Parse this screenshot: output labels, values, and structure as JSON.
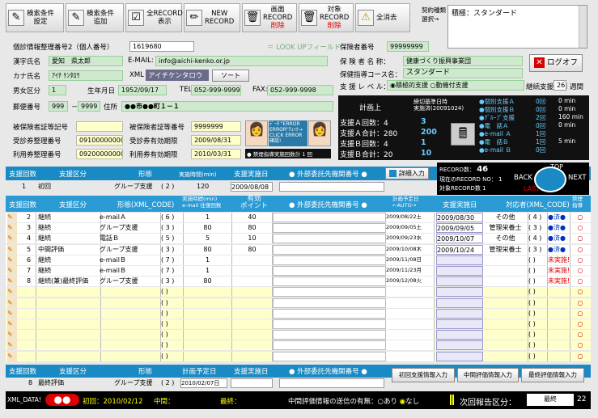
{
  "toolbar": {
    "search_settings": "検索条件\n設定",
    "search_add": "検索条件\n追加",
    "all_display": "全RECORD\n表示",
    "new_record": "NEW\nRECORD",
    "screen_record": "画面\nRECORD",
    "screen_record_sub": "削除",
    "target_record": "対象\nRECORD",
    "target_record_sub": "削除",
    "all_clear": "全消去",
    "contract_label": "契約種類\n選択→",
    "contract_value": "積極：スタンダード"
  },
  "person": {
    "card_no_label": "個診情報整理番号2（個人番号）",
    "card_no": "1619680",
    "lookup": "＝ LOOK UPフィールド",
    "kanji_label": "漢字氏名",
    "kanji": "愛知　県太郎",
    "email_label": "E-MAIL:",
    "email": "info@aichi-kenko.or.jp",
    "kana_label": "カナ氏名",
    "kana": "ｱｲﾁ ｹﾝﾀﾛｳ",
    "xml_label": "XML",
    "xml_kana": "アイチケンタロウ",
    "sort": "ソート",
    "gender_label": "男女区分",
    "gender": "1",
    "birth_label": "生年月日",
    "birth": "1952/09/17",
    "tel_label": "TEL:",
    "tel": "052-999-9999",
    "fax_label": "FAX:",
    "fax": "052-999-9998",
    "post_label": "郵便番号",
    "post1": "999",
    "post2": "9999",
    "addr_label": "住所",
    "addr": "●●市●●町１－１"
  },
  "insurer": {
    "no_label": "保険者番号",
    "no": "99999999",
    "name_label": "保 険 者 名 称：",
    "name": "健康づくり振興事業団",
    "course_label": "保健指導コース名：",
    "course": "スタンダード",
    "level_label": "支 援 レ ベ ル：",
    "level_opt1": "積極的支援",
    "level_opt2": "動機付支援",
    "period_label": "継続支援期間",
    "period": "26",
    "weeks": "週間",
    "logoff": "ログオフ"
  },
  "ins_cards": {
    "r1_label": "被保険者証等記号",
    "r1_label2": "被保険者証等番号",
    "r1_val2": "9999999",
    "r2_label": "受診券整理番号",
    "r2_val": "09100000000",
    "r2_label2": "受診券有効期限",
    "r2_val2": "2009/08/31",
    "r3_label": "利用券整理番号",
    "r3_val": "09200000000",
    "r3_label2": "利用券有効期限",
    "r3_val2": "2010/03/31",
    "err_text": "ﾃﾞｰﾀ \"ERROR ERROR\"ﾁｪｯｸ→ CLICK ERROR確認!",
    "check_label": "● 禁煙指導実施回数計 1 回"
  },
  "plan": {
    "title": "計画上",
    "actual_label": "実施済(",
    "cut_label": "締切基準日時",
    "cut_date": "20091024",
    "rows": [
      {
        "label": "支援Ａ回数：4",
        "v": "3"
      },
      {
        "label": "支援Ａ合計：280",
        "v": "200"
      },
      {
        "label": "支援Ｂ回数：4",
        "v": "1"
      },
      {
        "label": "支援Ｂ合計：20",
        "v": "10"
      }
    ],
    "right": [
      {
        "l": "●個別支援Ａ",
        "n": "0回",
        "m": "0 min"
      },
      {
        "l": "●個別支援Ｂ",
        "n": "0回",
        "m": "0 min"
      },
      {
        "l": "●ｸﾞﾙｰﾌﾟ支援",
        "n": "2回",
        "m": "160 min"
      },
      {
        "l": "●電　話Ａ",
        "n": "0回",
        "m": "0 min"
      },
      {
        "l": "●e-mail Ａ",
        "n": "1回",
        "m": ""
      },
      {
        "l": "●電　話Ｂ",
        "n": "1回",
        "m": "5 min"
      },
      {
        "l": "●e-mail Ｂ",
        "n": "0回",
        "m": ""
      }
    ]
  },
  "nav": {
    "rec_label": "RECORD数：",
    "rec": "46",
    "cur_label": "現在のRECORD NO：",
    "cur": "1",
    "tgt_label": "対象RECORD数",
    "tgt": "1",
    "top": "TOP",
    "back": "BACK",
    "next": "NEXT",
    "last": "LAST"
  },
  "first_section": {
    "headers": [
      "支援回数",
      "支援区分",
      "形態",
      "実施時間(min)",
      "支援実施日",
      "● 外部委託先機関番号 ●"
    ],
    "detail_btn": "詳細入力",
    "row": {
      "no": "1",
      "kubun": "初回",
      "keitai": "グループ支援",
      "code": "( 2 )",
      "time": "120",
      "date": "2009/08/08"
    }
  },
  "cont_section": {
    "headers": [
      "支援回数",
      "支援区分",
      "形態(XML_CODE)",
      "実施時間(min)\ne-mail 往復回数",
      "有効\nポイント",
      "● 外部委託先機関番号 ●",
      "計画予定日\n←AUTO→",
      "支援実施日",
      "対応者(XML_CODE)",
      "禁煙\n指導"
    ],
    "rows": [
      {
        "no": "2",
        "kubun": "継続",
        "keitai": "e-mailＡ",
        "code": "( 6 )",
        "time": "1",
        "pt": "40",
        "plan": "2009/08/22土",
        "date": "2009/08/30",
        "who": "その他",
        "wcode": "( 4 )",
        "st": "●済●"
      },
      {
        "no": "3",
        "kubun": "継続",
        "keitai": "グループ支援",
        "code": "( 3 )",
        "time": "80",
        "pt": "80",
        "plan": "2009/09/05土",
        "date": "2009/09/05",
        "who": "管理栄養士",
        "wcode": "( 3 )",
        "st": "●済●"
      },
      {
        "no": "4",
        "kubun": "継続",
        "keitai": "電話Ｂ",
        "code": "( 5 )",
        "time": "5",
        "pt": "10",
        "plan": "2009/09/23水",
        "date": "2009/10/07",
        "who": "その他",
        "wcode": "( 4 )",
        "st": "●済●"
      },
      {
        "no": "5",
        "kubun": "中間評価",
        "keitai": "グループ支援",
        "code": "( 3 )",
        "time": "80",
        "pt": "80",
        "plan": "2009/10/08木",
        "date": "2009/10/24",
        "who": "管理栄養士",
        "wcode": "( 3 )",
        "st": "●済●"
      },
      {
        "no": "6",
        "kubun": "継続",
        "keitai": "e-mailＢ",
        "code": "( 7 )",
        "time": "1",
        "pt": "",
        "plan": "2009/11/08日",
        "date": "",
        "who": "",
        "wcode": "(   )",
        "st": "未実施!"
      },
      {
        "no": "7",
        "kubun": "継続",
        "keitai": "e-mailＢ",
        "code": "( 7 )",
        "time": "1",
        "pt": "",
        "plan": "2009/11/23月",
        "date": "",
        "who": "",
        "wcode": "(   )",
        "st": "未実施!"
      },
      {
        "no": "8",
        "kubun": "継続(兼)最終評価",
        "keitai": "グループ支援",
        "code": "( 3 )",
        "time": "80",
        "pt": "",
        "plan": "2009/12/08火",
        "date": "",
        "who": "",
        "wcode": "(   )",
        "st": "未実施!"
      },
      {
        "no": "",
        "kubun": "",
        "keitai": "",
        "code": "(   )",
        "time": "",
        "pt": "",
        "plan": "",
        "date": "",
        "who": "",
        "wcode": "(   )",
        "st": ""
      },
      {
        "no": "",
        "kubun": "",
        "keitai": "",
        "code": "(   )",
        "time": "",
        "pt": "",
        "plan": "",
        "date": "",
        "who": "",
        "wcode": "(   )",
        "st": ""
      },
      {
        "no": "",
        "kubun": "",
        "keitai": "",
        "code": "(   )",
        "time": "",
        "pt": "",
        "plan": "",
        "date": "",
        "who": "",
        "wcode": "(   )",
        "st": ""
      },
      {
        "no": "",
        "kubun": "",
        "keitai": "",
        "code": "(   )",
        "time": "",
        "pt": "",
        "plan": "",
        "date": "",
        "who": "",
        "wcode": "(   )",
        "st": ""
      },
      {
        "no": "",
        "kubun": "",
        "keitai": "",
        "code": "(   )",
        "time": "",
        "pt": "",
        "plan": "",
        "date": "",
        "who": "",
        "wcode": "(   )",
        "st": ""
      },
      {
        "no": "",
        "kubun": "",
        "keitai": "",
        "code": "(   )",
        "time": "",
        "pt": "",
        "plan": "",
        "date": "",
        "who": "",
        "wcode": "(   )",
        "st": ""
      },
      {
        "no": "",
        "kubun": "",
        "keitai": "",
        "code": "(   )",
        "time": "",
        "pt": "",
        "plan": "",
        "date": "",
        "who": "",
        "wcode": "(   )",
        "st": ""
      }
    ]
  },
  "final_section": {
    "headers": [
      "支援回数",
      "支援区分",
      "形態",
      "計画予定日",
      "支援実施日",
      "● 外部委託先機関番号 ●"
    ],
    "row": {
      "no": "8",
      "kubun": "最終評価",
      "keitai": "グループ支援",
      "code": "( 2 )",
      "plan": "2010/02/07日",
      "date": ""
    },
    "btn1": "初回支援情報入力",
    "btn2": "中間評価情報入力",
    "btn3": "最終評価情報入力"
  },
  "status": {
    "xml": "XML_DATA!",
    "first": "初回：2010/02/12",
    "middle": "中間：",
    "last": "最終：",
    "send_label": "中間評価情報の送信の有無：",
    "opt1": "あり",
    "opt2": "なし",
    "report_label": "次回報告区分：",
    "report": "最終",
    "num": "22"
  }
}
